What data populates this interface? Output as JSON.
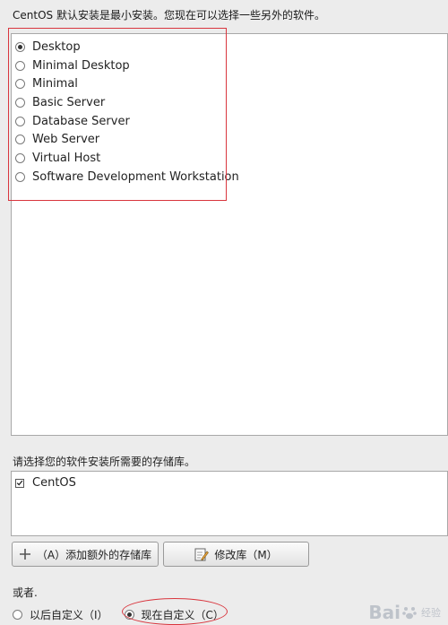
{
  "intro_text": "CentOS 默认安装是最小安装。您现在可以选择一些另外的软件。",
  "install_groups": [
    {
      "label": "Desktop",
      "selected": true
    },
    {
      "label": "Minimal Desktop",
      "selected": false
    },
    {
      "label": "Minimal",
      "selected": false
    },
    {
      "label": "Basic Server",
      "selected": false
    },
    {
      "label": "Database Server",
      "selected": false
    },
    {
      "label": "Web Server",
      "selected": false
    },
    {
      "label": "Virtual Host",
      "selected": false
    },
    {
      "label": "Software Development Workstation",
      "selected": false
    }
  ],
  "repo_prompt": "请选择您的软件安装所需要的存储库。",
  "repos": [
    {
      "label": "CentOS",
      "checked": true
    }
  ],
  "buttons": {
    "add_repo": "（A）添加额外的存储库",
    "modify_repo": "修改库（M）"
  },
  "or_label": "或者.",
  "customize": {
    "later": "以后自定义（I）",
    "now": "现在自定义（C）",
    "selected": "now"
  },
  "watermark": {
    "brand": "Bai",
    "suffix": "经验"
  },
  "colors": {
    "highlight": "#d9363e"
  }
}
